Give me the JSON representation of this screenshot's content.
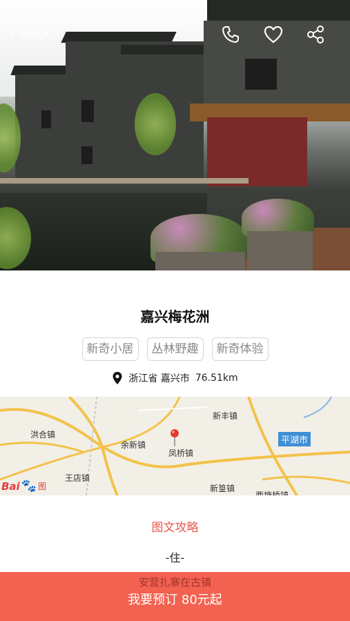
{
  "header": {
    "back_label": "Back",
    "icons": [
      "phone-icon",
      "heart-icon",
      "share-icon"
    ]
  },
  "place": {
    "name": "嘉兴梅花洲",
    "tags": [
      "新奇小居",
      "丛林野趣",
      "新奇体验"
    ],
    "location": "浙江省 嘉兴市",
    "distance": "76.51km"
  },
  "map": {
    "labels": [
      "新丰镇",
      "洪合镇",
      "余新镇",
      "凤桥镇",
      "王店镇",
      "新篁镇",
      "西塘桥镇"
    ],
    "city_label": "平湖市",
    "brand_bai": "Bai",
    "brand_du": "图"
  },
  "content": {
    "guide_link": "图文攻略",
    "section_title": "-住-",
    "peek_text": "安营扎寨在古镇"
  },
  "booking": {
    "button_label": "我要预订  80元起"
  },
  "colors": {
    "accent": "#f36150",
    "link": "#e9574b",
    "map_city": "#3f8fd6"
  }
}
